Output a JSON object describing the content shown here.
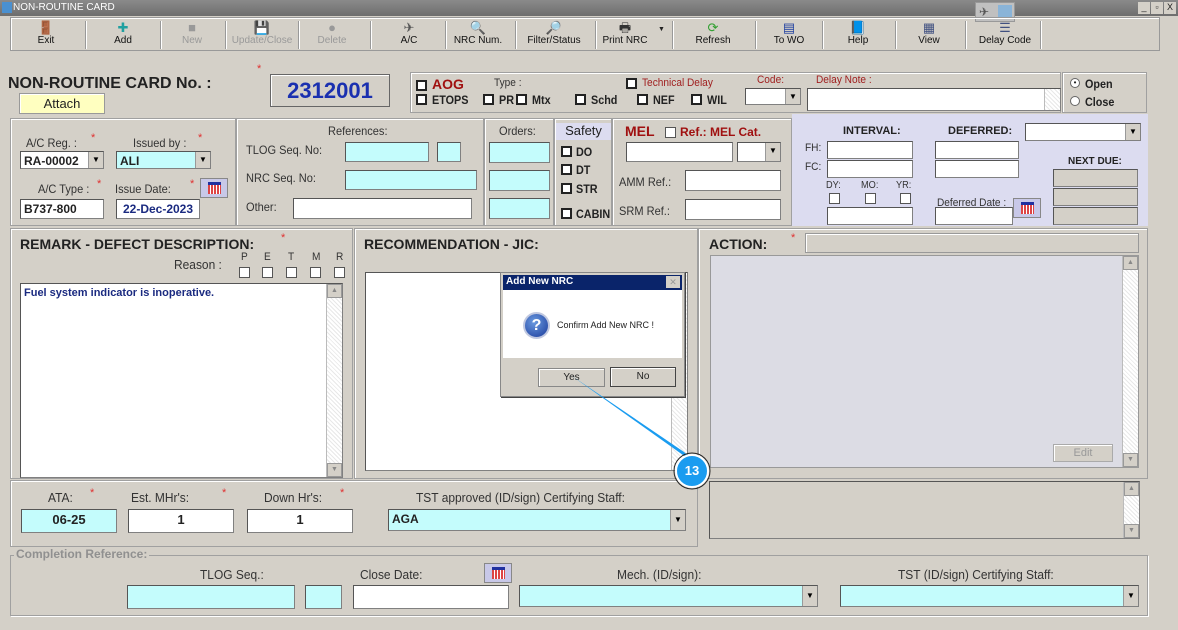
{
  "window": {
    "title": "NON-ROUTINE CARD",
    "controls": [
      "_",
      "▫",
      "X"
    ]
  },
  "toolbar": [
    {
      "label": "Exit",
      "icon": "exit-icon",
      "glyph": "🚪",
      "enabled": true
    },
    {
      "label": "Add",
      "icon": "add-icon",
      "glyph": "✚",
      "enabled": true
    },
    {
      "label": "New",
      "icon": "new-icon",
      "glyph": "■",
      "enabled": false
    },
    {
      "label": "Update/Close",
      "icon": "save-icon",
      "glyph": "💾",
      "enabled": false
    },
    {
      "label": "Delete",
      "icon": "delete-icon",
      "glyph": "●",
      "enabled": false
    },
    {
      "label": "A/C",
      "icon": "aircraft-icon",
      "glyph": "✈",
      "enabled": true
    },
    {
      "label": "NRC Num.",
      "icon": "nrc-search-icon",
      "glyph": "🔍",
      "enabled": true
    },
    {
      "label": "Filter/Status",
      "icon": "filter-icon",
      "glyph": "🔎",
      "enabled": true
    },
    {
      "label": "Print NRC",
      "icon": "printer-icon",
      "glyph": "🖶",
      "enabled": true
    },
    {
      "label": "Refresh",
      "icon": "refresh-icon",
      "glyph": "⟳",
      "enabled": true
    },
    {
      "label": "To WO",
      "icon": "to-wo-icon",
      "glyph": "▤",
      "enabled": true
    },
    {
      "label": "Help",
      "icon": "help-icon",
      "glyph": "📘",
      "enabled": true
    },
    {
      "label": "View",
      "icon": "view-icon",
      "glyph": "▦",
      "enabled": true
    },
    {
      "label": "Delay Code",
      "icon": "delay-code-icon",
      "glyph": "☰",
      "enabled": true
    }
  ],
  "header": {
    "card_label": "NON-ROUTINE CARD No. :",
    "card_number": "2312001",
    "attach": "Attach",
    "aog": "AOG",
    "type_label": "Type :",
    "technical_delay": "Technical Delay",
    "code_label": "Code:",
    "delay_note_label": "Delay Note :",
    "types": [
      "ETOPS",
      "PR",
      "Mtx",
      "Schd",
      "NEF",
      "WIL"
    ],
    "open": "Open",
    "close": "Close",
    "status": "Open"
  },
  "aircraft": {
    "reg_label": "A/C Reg. :",
    "reg": "RA-00002",
    "issued_by_label": "Issued by :",
    "issued_by": "ALI",
    "type_label": "A/C Type :",
    "type": "B737-800",
    "issue_date_label": "Issue Date:",
    "issue_date": "22-Dec-2023"
  },
  "references": {
    "title": "References:",
    "tlog": "TLOG Seq. No:",
    "nrc": "NRC Seq. No:",
    "other": "Other:",
    "orders": "Orders:"
  },
  "safety": {
    "tab": "Safety",
    "items": [
      "DO",
      "DT",
      "STR",
      "CABIN"
    ]
  },
  "mel": {
    "title": "MEL",
    "ref": "Ref.: MEL Cat.",
    "amm": "AMM Ref.:",
    "srm": "SRM Ref.:"
  },
  "interval": {
    "interval": "INTERVAL:",
    "deferred": "DEFERRED:",
    "fh": "FH:",
    "fc": "FC:",
    "dy": "DY:",
    "mo": "MO:",
    "yr": "YR:",
    "deferred_date": "Deferred Date :",
    "next_due": "NEXT DUE:"
  },
  "remark": {
    "title": "REMARK - DEFECT DESCRIPTION:",
    "reason": "Reason :",
    "reasons": [
      "P",
      "E",
      "T",
      "M",
      "R"
    ],
    "text": "Fuel system indicator is inoperative."
  },
  "recommendation": {
    "title": "RECOMMENDATION - JIC:"
  },
  "action": {
    "title": "ACTION:",
    "edit": "Edit"
  },
  "bottom": {
    "ata_label": "ATA:",
    "ata": "06-25",
    "mhr_label": "Est. MHr's:",
    "mhr": "1",
    "down_label": "Down Hr's:",
    "down": "1",
    "tst_label": "TST approved (ID/sign) Certifying Staff:",
    "tst": "AGA"
  },
  "completion": {
    "legend": "Completion Reference:",
    "tlog": "TLOG Seq.:",
    "close_date": "Close Date:",
    "mech": "Mech. (ID/sign):",
    "tst": "TST (ID/sign) Certifying Staff:"
  },
  "dialog": {
    "title": "Add New NRC",
    "message": "Confirm Add New NRC !",
    "yes": "Yes",
    "no": "No"
  },
  "callout": {
    "step": "13",
    "color": "#1a9cf0"
  }
}
